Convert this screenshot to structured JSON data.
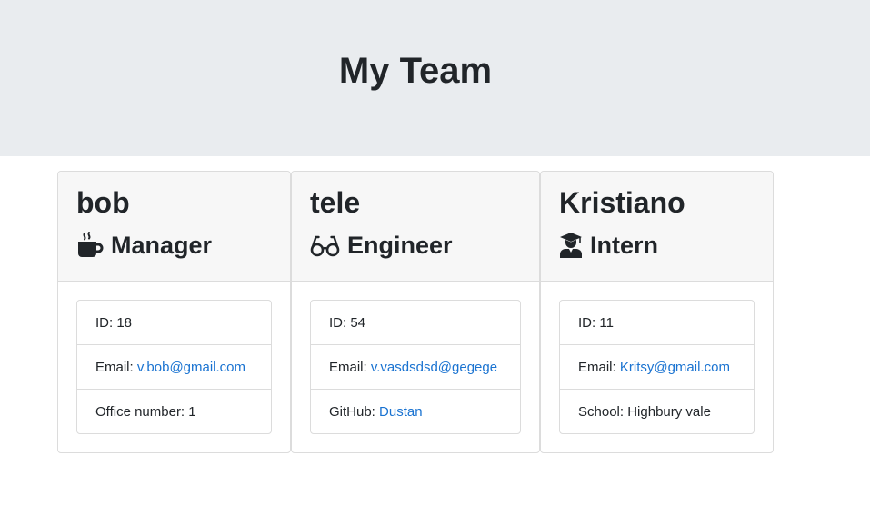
{
  "header": {
    "title": "My Team"
  },
  "cards": [
    {
      "name": "bob",
      "role": "Manager",
      "role_icon": "mug-icon",
      "id_label": "ID: ",
      "id": "18",
      "email_label": "Email: ",
      "email": "v.bob@gmail.com",
      "extra_label": "Office number: ",
      "extra_value": "1"
    },
    {
      "name": "tele",
      "role": "Engineer",
      "role_icon": "glasses-icon",
      "id_label": "ID: ",
      "id": "54",
      "email_label": "Email: ",
      "email": "v.vasdsdsd@gegege",
      "extra_label": "GitHub: ",
      "extra_value": "Dustan"
    },
    {
      "name": "Kristiano",
      "role": "Intern",
      "role_icon": "graduate-icon",
      "id_label": "ID: ",
      "id": "11",
      "email_label": "Email: ",
      "email": "Kritsy@gmail.com",
      "extra_label": "School: ",
      "extra_value": "Highbury vale"
    }
  ],
  "colors": {
    "link": "#1a73d1",
    "jumbotron": "#e9ecef",
    "card_header": "#f7f7f7"
  }
}
